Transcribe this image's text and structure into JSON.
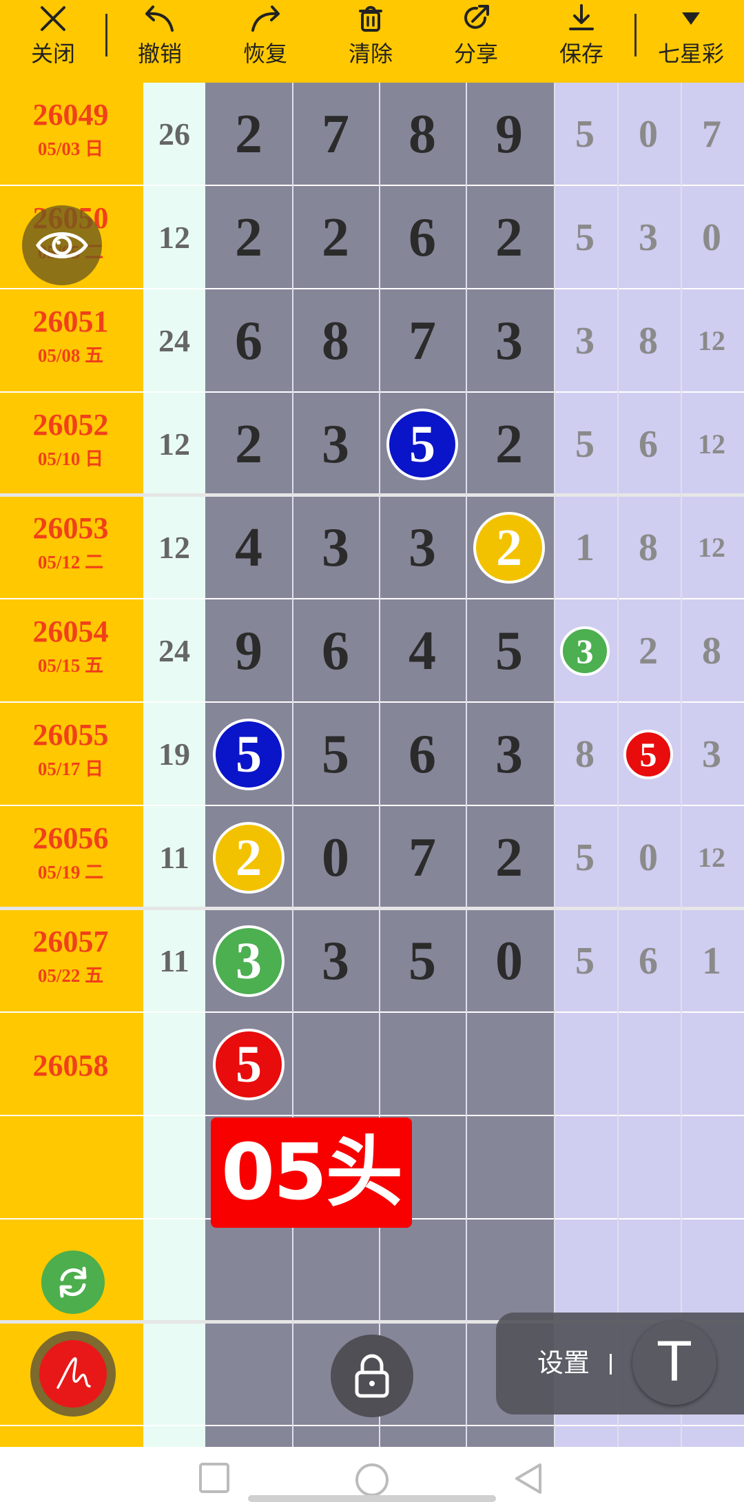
{
  "toolbar": {
    "buttons": [
      {
        "label": "关闭",
        "icon": "close-icon"
      },
      {
        "label": "撤销",
        "icon": "undo-icon"
      },
      {
        "label": "恢复",
        "icon": "redo-icon"
      },
      {
        "label": "清除",
        "icon": "trash-icon"
      },
      {
        "label": "分享",
        "icon": "share-icon"
      },
      {
        "label": "保存",
        "icon": "download-icon"
      }
    ],
    "lottery": {
      "label": "七星彩",
      "icon": "triangle-down-icon"
    }
  },
  "rows": [
    {
      "issue": "26049",
      "date": "05/03 日",
      "sum": "26",
      "digits": [
        "2",
        "7",
        "8",
        "9"
      ],
      "stats": [
        "5",
        "0",
        "7"
      ]
    },
    {
      "issue": "26050",
      "date": "05/05 二",
      "sum": "12",
      "digits": [
        "2",
        "2",
        "6",
        "2"
      ],
      "stats": [
        "5",
        "3",
        "0"
      ]
    },
    {
      "issue": "26051",
      "date": "05/08 五",
      "sum": "24",
      "digits": [
        "6",
        "8",
        "7",
        "3"
      ],
      "stats": [
        "3",
        "8",
        "12"
      ]
    },
    {
      "issue": "26052",
      "date": "05/10 日",
      "sum": "12",
      "digits": [
        "2",
        "3",
        "5",
        "2"
      ],
      "stats": [
        "5",
        "6",
        "12"
      ]
    },
    {
      "issue": "26053",
      "date": "05/12 二",
      "sum": "12",
      "digits": [
        "4",
        "3",
        "3",
        "2"
      ],
      "stats": [
        "1",
        "8",
        "12"
      ]
    },
    {
      "issue": "26054",
      "date": "05/15 五",
      "sum": "24",
      "digits": [
        "9",
        "6",
        "4",
        "5"
      ],
      "stats": [
        "3",
        "2",
        "8"
      ]
    },
    {
      "issue": "26055",
      "date": "05/17 日",
      "sum": "19",
      "digits": [
        "5",
        "5",
        "6",
        "3"
      ],
      "stats": [
        "8",
        "5",
        "3"
      ]
    },
    {
      "issue": "26056",
      "date": "05/19 二",
      "sum": "11",
      "digits": [
        "2",
        "0",
        "7",
        "2"
      ],
      "stats": [
        "5",
        "0",
        "12"
      ]
    },
    {
      "issue": "26057",
      "date": "05/22 五",
      "sum": "11",
      "digits": [
        "3",
        "3",
        "5",
        "0"
      ],
      "stats": [
        "5",
        "6",
        "1"
      ]
    },
    {
      "issue": "26058",
      "date": "",
      "sum": "",
      "digits": [
        "5",
        "",
        "",
        ""
      ],
      "stats": [
        "",
        "",
        ""
      ]
    }
  ],
  "markers": [
    {
      "row": 3,
      "col": "digit",
      "index": 2,
      "color": "#0a14c8"
    },
    {
      "row": 4,
      "col": "digit",
      "index": 3,
      "color": "#f2c200"
    },
    {
      "row": 5,
      "col": "stat",
      "index": 0,
      "color": "#4caf50"
    },
    {
      "row": 6,
      "col": "digit",
      "index": 0,
      "color": "#0a14c8"
    },
    {
      "row": 6,
      "col": "stat",
      "index": 1,
      "color": "#e80c0c"
    },
    {
      "row": 7,
      "col": "digit",
      "index": 0,
      "color": "#f2c200"
    },
    {
      "row": 8,
      "col": "digit",
      "index": 0,
      "color": "#4caf50"
    },
    {
      "row": 9,
      "col": "digit",
      "index": 0,
      "color": "#e80c0c"
    }
  ],
  "overlay_label": "05头",
  "settings": {
    "label": "设置"
  },
  "tools": {
    "eye": "eye-icon",
    "refresh": "refresh-icon",
    "pen": "pen-icon",
    "lock": "lock-icon",
    "text": "text-tool-icon"
  },
  "colors": {
    "toolbar": "#ffc800",
    "issue_column": "#ffc800",
    "issue_text": "#f0401a",
    "sum_column": "#e8fbf4",
    "digit_area": "#868699",
    "stats_area": "#cfcdf0"
  }
}
